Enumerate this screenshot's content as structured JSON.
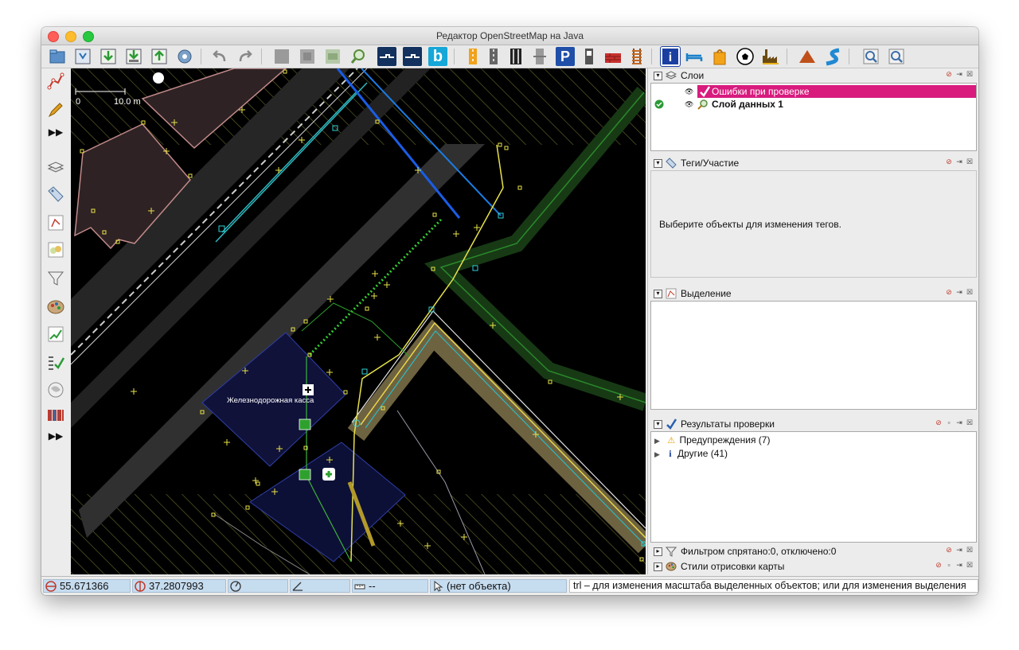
{
  "window": {
    "title": "Редактор OpenStreetMap на Java"
  },
  "colors": {
    "selection_magenta": "#d81b7d",
    "status_field": "#c6dcef",
    "map_background": "#000000"
  },
  "toolbar": {
    "buttons": [
      {
        "name": "open-file-icon"
      },
      {
        "name": "save-icon"
      },
      {
        "name": "download-icon"
      },
      {
        "name": "download-data-icon"
      },
      {
        "name": "upload-icon"
      },
      {
        "name": "preferences-icon"
      },
      {
        "name": "undo-icon"
      },
      {
        "name": "redo-icon"
      },
      {
        "name": "copy-icon"
      },
      {
        "name": "paste-icon"
      },
      {
        "name": "paste-tags-icon"
      },
      {
        "name": "search-icon"
      },
      {
        "name": "imagery-icon-1"
      },
      {
        "name": "imagery-icon-2"
      },
      {
        "name": "bing-icon"
      },
      {
        "name": "road-preset-icon-1"
      },
      {
        "name": "road-preset-icon-2"
      },
      {
        "name": "road-preset-icon-3"
      },
      {
        "name": "road-preset-icon-4"
      },
      {
        "name": "parking-icon"
      },
      {
        "name": "fuel-icon"
      },
      {
        "name": "wall-icon"
      },
      {
        "name": "railway-icon"
      },
      {
        "name": "info-icon"
      },
      {
        "name": "hotel-icon"
      },
      {
        "name": "shop-icon"
      },
      {
        "name": "sport-icon"
      },
      {
        "name": "industrial-icon"
      },
      {
        "name": "peak-icon"
      },
      {
        "name": "waterway-icon"
      },
      {
        "name": "zoom-in-icon"
      },
      {
        "name": "zoom-out-icon"
      }
    ],
    "bing_letter": "b",
    "parking_letter": "P",
    "info_letter": "i"
  },
  "left_tools": {
    "items": [
      {
        "name": "select-tool-icon"
      },
      {
        "name": "draw-tool-icon"
      },
      {
        "name": "more-tools-icon"
      },
      {
        "name": "layers-toggle-icon"
      },
      {
        "name": "tags-toggle-icon"
      },
      {
        "name": "selection-toggle-icon"
      },
      {
        "name": "relations-toggle-icon"
      },
      {
        "name": "filter-toggle-icon"
      },
      {
        "name": "map-styles-toggle-icon"
      },
      {
        "name": "validator-toggle-icon"
      },
      {
        "name": "changeset-toggle-icon"
      },
      {
        "name": "imagery-toggle-icon"
      },
      {
        "name": "authors-toggle-icon"
      },
      {
        "name": "more-panels-icon"
      }
    ]
  },
  "map": {
    "scale_left": "0",
    "scale_right": "10.0 m",
    "label_station": "Железнодорожная касса"
  },
  "panels": {
    "layers": {
      "title": "Слои",
      "items": [
        {
          "label": "Ошибки при проверке",
          "selected": true
        },
        {
          "label": "Слой данных 1",
          "active": true
        }
      ]
    },
    "tags": {
      "title": "Теги/Участие",
      "empty_text": "Выберите объекты для изменения тегов."
    },
    "selection": {
      "title": "Выделение"
    },
    "validation": {
      "title": "Результаты проверки",
      "items": [
        {
          "label": "Предупреждения (7)"
        },
        {
          "label": "Другие (41)"
        }
      ],
      "info_glyph": "i"
    },
    "filter": {
      "title": "Фильтром спрятано:0, отключено:0"
    },
    "styles": {
      "title": "Стили отрисовки карты"
    }
  },
  "status": {
    "lat": "55.671366",
    "lon": "37.2807993",
    "heading": "",
    "angle": "",
    "distance": "--",
    "object": "(нет объекта)",
    "hint": "trl – для изменения масштаба выделенных объектов; или для изменения выделения"
  }
}
